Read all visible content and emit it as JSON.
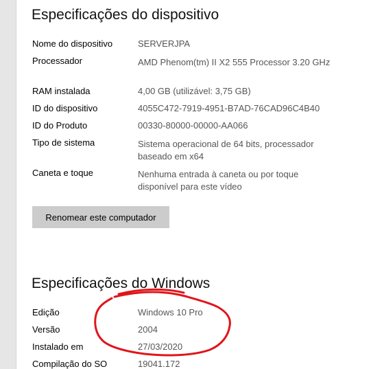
{
  "device_specs": {
    "title": "Especificações do dispositivo",
    "rows": [
      {
        "label": "Nome do dispositivo",
        "value": "SERVERJPA"
      },
      {
        "label": "Processador",
        "value": "AMD Phenom(tm) II X2 555 Processor   3.20 GHz"
      },
      {
        "label": "RAM instalada",
        "value": "4,00 GB (utilizável: 3,75 GB)"
      },
      {
        "label": "ID do dispositivo",
        "value": "4055C472-7919-4951-B7AD-76CAD96C4B40"
      },
      {
        "label": "ID do Produto",
        "value": "00330-80000-00000-AA066"
      },
      {
        "label": "Tipo de sistema",
        "value": "Sistema operacional de 64 bits, processador baseado em x64"
      },
      {
        "label": "Caneta e toque",
        "value": "Nenhuma entrada à caneta ou por toque disponível para este vídeo"
      }
    ],
    "rename_button": "Renomear este computador"
  },
  "windows_specs": {
    "title": "Especificações do Windows",
    "rows": [
      {
        "label": "Edição",
        "value": "Windows 10 Pro"
      },
      {
        "label": "Versão",
        "value": "2004"
      },
      {
        "label": "Instalado em",
        "value": "27/03/2020"
      },
      {
        "label": "Compilação do SO",
        "value": "19041.172"
      }
    ]
  },
  "colors": {
    "annotation": "#e0151b",
    "button_bg": "#cccccc",
    "value_text": "#555555"
  }
}
